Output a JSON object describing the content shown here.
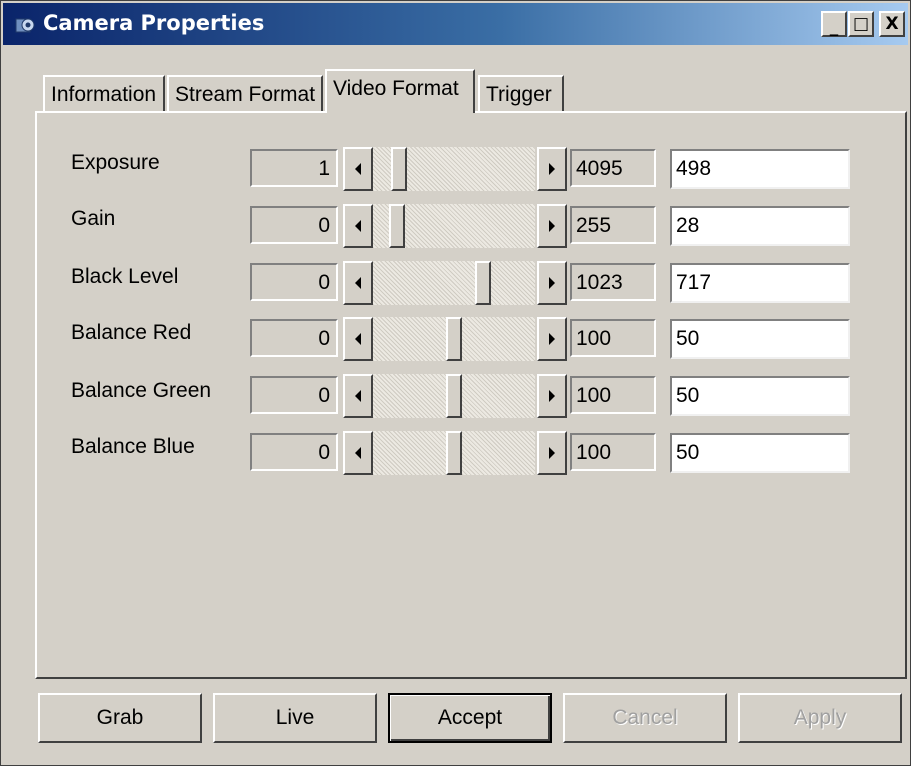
{
  "window": {
    "title": "Camera Properties",
    "minimize_glyph": "_",
    "maximize_glyph": "□",
    "close_glyph": "X",
    "icon": "camera-icon"
  },
  "tabs": [
    {
      "label": "Information",
      "active": false
    },
    {
      "label": "Stream Format",
      "active": false
    },
    {
      "label": "Video Format",
      "active": true
    },
    {
      "label": "Trigger",
      "active": false
    }
  ],
  "rows": [
    {
      "label": "Exposure",
      "min": "1",
      "max": "4095",
      "value": "498"
    },
    {
      "label": "Gain",
      "min": "0",
      "max": "255",
      "value": "28"
    },
    {
      "label": "Black Level",
      "min": "0",
      "max": "1023",
      "value": "717"
    },
    {
      "label": "Balance Red",
      "min": "0",
      "max": "100",
      "value": "50"
    },
    {
      "label": "Balance Green",
      "min": "0",
      "max": "100",
      "value": "50"
    },
    {
      "label": "Balance Blue",
      "min": "0",
      "max": "100",
      "value": "50"
    }
  ],
  "buttons": [
    {
      "label": "Grab",
      "enabled": true,
      "default": false
    },
    {
      "label": "Live",
      "enabled": true,
      "default": false
    },
    {
      "label": "Accept",
      "enabled": true,
      "default": true
    },
    {
      "label": "Cancel",
      "enabled": false,
      "default": false
    },
    {
      "label": "Apply",
      "enabled": false,
      "default": false
    }
  ]
}
